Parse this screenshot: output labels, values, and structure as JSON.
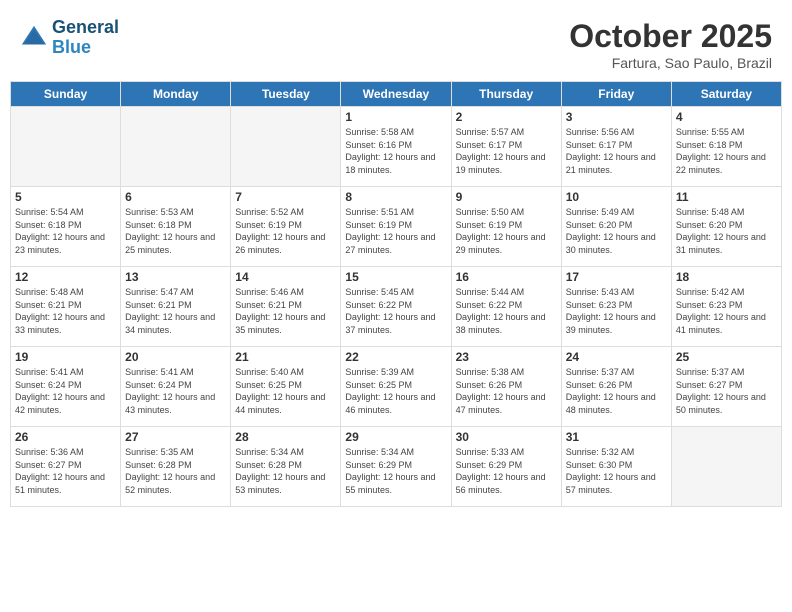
{
  "header": {
    "logo_line1": "General",
    "logo_line2": "Blue",
    "month": "October 2025",
    "location": "Fartura, Sao Paulo, Brazil"
  },
  "weekdays": [
    "Sunday",
    "Monday",
    "Tuesday",
    "Wednesday",
    "Thursday",
    "Friday",
    "Saturday"
  ],
  "weeks": [
    [
      {
        "day": "",
        "info": ""
      },
      {
        "day": "",
        "info": ""
      },
      {
        "day": "",
        "info": ""
      },
      {
        "day": "1",
        "info": "Sunrise: 5:58 AM\nSunset: 6:16 PM\nDaylight: 12 hours and 18 minutes."
      },
      {
        "day": "2",
        "info": "Sunrise: 5:57 AM\nSunset: 6:17 PM\nDaylight: 12 hours and 19 minutes."
      },
      {
        "day": "3",
        "info": "Sunrise: 5:56 AM\nSunset: 6:17 PM\nDaylight: 12 hours and 21 minutes."
      },
      {
        "day": "4",
        "info": "Sunrise: 5:55 AM\nSunset: 6:18 PM\nDaylight: 12 hours and 22 minutes."
      }
    ],
    [
      {
        "day": "5",
        "info": "Sunrise: 5:54 AM\nSunset: 6:18 PM\nDaylight: 12 hours and 23 minutes."
      },
      {
        "day": "6",
        "info": "Sunrise: 5:53 AM\nSunset: 6:18 PM\nDaylight: 12 hours and 25 minutes."
      },
      {
        "day": "7",
        "info": "Sunrise: 5:52 AM\nSunset: 6:19 PM\nDaylight: 12 hours and 26 minutes."
      },
      {
        "day": "8",
        "info": "Sunrise: 5:51 AM\nSunset: 6:19 PM\nDaylight: 12 hours and 27 minutes."
      },
      {
        "day": "9",
        "info": "Sunrise: 5:50 AM\nSunset: 6:19 PM\nDaylight: 12 hours and 29 minutes."
      },
      {
        "day": "10",
        "info": "Sunrise: 5:49 AM\nSunset: 6:20 PM\nDaylight: 12 hours and 30 minutes."
      },
      {
        "day": "11",
        "info": "Sunrise: 5:48 AM\nSunset: 6:20 PM\nDaylight: 12 hours and 31 minutes."
      }
    ],
    [
      {
        "day": "12",
        "info": "Sunrise: 5:48 AM\nSunset: 6:21 PM\nDaylight: 12 hours and 33 minutes."
      },
      {
        "day": "13",
        "info": "Sunrise: 5:47 AM\nSunset: 6:21 PM\nDaylight: 12 hours and 34 minutes."
      },
      {
        "day": "14",
        "info": "Sunrise: 5:46 AM\nSunset: 6:21 PM\nDaylight: 12 hours and 35 minutes."
      },
      {
        "day": "15",
        "info": "Sunrise: 5:45 AM\nSunset: 6:22 PM\nDaylight: 12 hours and 37 minutes."
      },
      {
        "day": "16",
        "info": "Sunrise: 5:44 AM\nSunset: 6:22 PM\nDaylight: 12 hours and 38 minutes."
      },
      {
        "day": "17",
        "info": "Sunrise: 5:43 AM\nSunset: 6:23 PM\nDaylight: 12 hours and 39 minutes."
      },
      {
        "day": "18",
        "info": "Sunrise: 5:42 AM\nSunset: 6:23 PM\nDaylight: 12 hours and 41 minutes."
      }
    ],
    [
      {
        "day": "19",
        "info": "Sunrise: 5:41 AM\nSunset: 6:24 PM\nDaylight: 12 hours and 42 minutes."
      },
      {
        "day": "20",
        "info": "Sunrise: 5:41 AM\nSunset: 6:24 PM\nDaylight: 12 hours and 43 minutes."
      },
      {
        "day": "21",
        "info": "Sunrise: 5:40 AM\nSunset: 6:25 PM\nDaylight: 12 hours and 44 minutes."
      },
      {
        "day": "22",
        "info": "Sunrise: 5:39 AM\nSunset: 6:25 PM\nDaylight: 12 hours and 46 minutes."
      },
      {
        "day": "23",
        "info": "Sunrise: 5:38 AM\nSunset: 6:26 PM\nDaylight: 12 hours and 47 minutes."
      },
      {
        "day": "24",
        "info": "Sunrise: 5:37 AM\nSunset: 6:26 PM\nDaylight: 12 hours and 48 minutes."
      },
      {
        "day": "25",
        "info": "Sunrise: 5:37 AM\nSunset: 6:27 PM\nDaylight: 12 hours and 50 minutes."
      }
    ],
    [
      {
        "day": "26",
        "info": "Sunrise: 5:36 AM\nSunset: 6:27 PM\nDaylight: 12 hours and 51 minutes."
      },
      {
        "day": "27",
        "info": "Sunrise: 5:35 AM\nSunset: 6:28 PM\nDaylight: 12 hours and 52 minutes."
      },
      {
        "day": "28",
        "info": "Sunrise: 5:34 AM\nSunset: 6:28 PM\nDaylight: 12 hours and 53 minutes."
      },
      {
        "day": "29",
        "info": "Sunrise: 5:34 AM\nSunset: 6:29 PM\nDaylight: 12 hours and 55 minutes."
      },
      {
        "day": "30",
        "info": "Sunrise: 5:33 AM\nSunset: 6:29 PM\nDaylight: 12 hours and 56 minutes."
      },
      {
        "day": "31",
        "info": "Sunrise: 5:32 AM\nSunset: 6:30 PM\nDaylight: 12 hours and 57 minutes."
      },
      {
        "day": "",
        "info": ""
      }
    ]
  ]
}
